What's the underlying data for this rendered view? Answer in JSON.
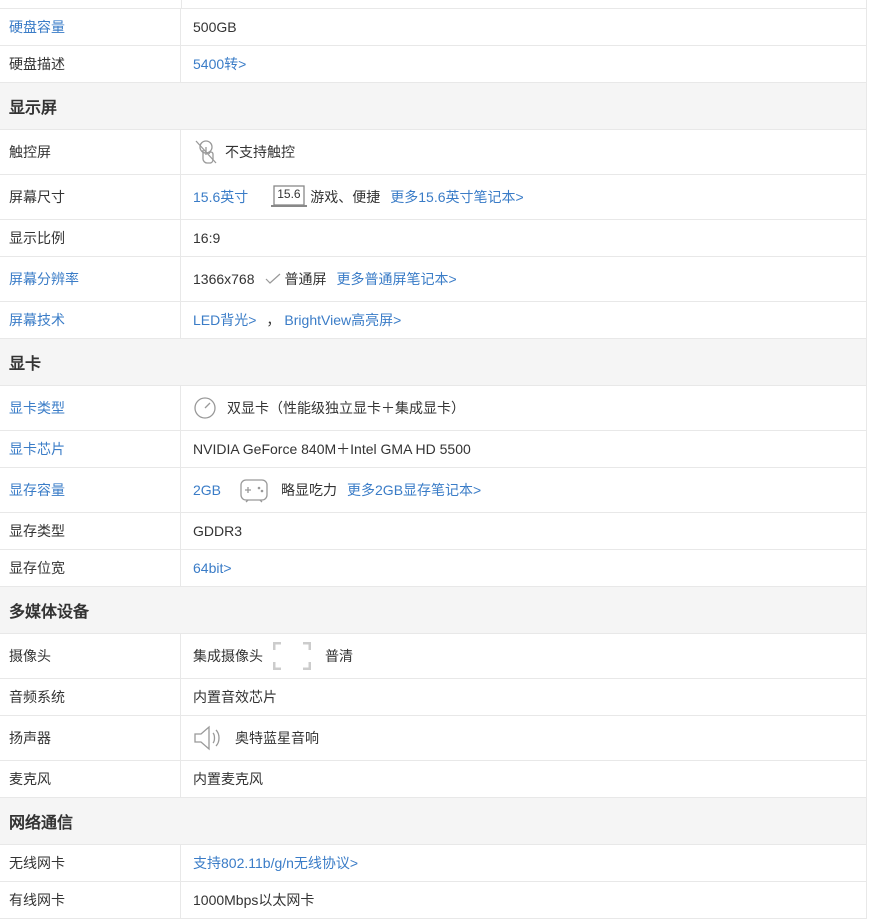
{
  "rows": {
    "disk_capacity": {
      "label": "硬盘容量",
      "value": "500GB"
    },
    "disk_desc": {
      "label": "硬盘描述",
      "value": "5400转>"
    },
    "touch": {
      "label": "触控屏",
      "value": "不支持触控"
    },
    "screen_size": {
      "label": "屏幕尺寸",
      "value": "15.6英寸",
      "badge": "15.6",
      "note": "游戏、便捷",
      "more": "更多15.6英寸笔记本>"
    },
    "aspect": {
      "label": "显示比例",
      "value": "16:9"
    },
    "resolution": {
      "label": "屏幕分辨率",
      "value": "1366x768",
      "note": "普通屏",
      "more": "更多普通屏笔记本>"
    },
    "screen_tech": {
      "label": "屏幕技术",
      "value1": "LED背光>",
      "sep": "，",
      "value2": "BrightView高亮屏>"
    },
    "gpu_type": {
      "label": "显卡类型",
      "value": "双显卡（性能级独立显卡＋集成显卡）"
    },
    "gpu_chip": {
      "label": "显卡芯片",
      "value": "NVIDIA GeForce 840M＋Intel GMA HD 5500"
    },
    "vram": {
      "label": "显存容量",
      "value": "2GB",
      "note": "略显吃力",
      "more": "更多2GB显存笔记本>"
    },
    "vram_type": {
      "label": "显存类型",
      "value": "GDDR3"
    },
    "vram_width": {
      "label": "显存位宽",
      "value": "64bit>"
    },
    "camera": {
      "label": "摄像头",
      "value": "集成摄像头",
      "note": "普清"
    },
    "audio": {
      "label": "音频系统",
      "value": "内置音效芯片"
    },
    "speaker": {
      "label": "扬声器",
      "value": "奥特蓝星音响"
    },
    "mic": {
      "label": "麦克风",
      "value": "内置麦克风"
    },
    "wifi": {
      "label": "无线网卡",
      "value": "支持802.11b/g/n无线协议>"
    },
    "lan": {
      "label": "有线网卡",
      "value": "1000Mbps以太网卡"
    }
  },
  "sections": {
    "display": "显示屏",
    "gpu": "显卡",
    "multimedia": "多媒体设备",
    "network": "网络通信"
  },
  "colors": {
    "link": "#3a7cc7",
    "border": "#e8e8e8",
    "section_bg": "#f5f5f5"
  }
}
